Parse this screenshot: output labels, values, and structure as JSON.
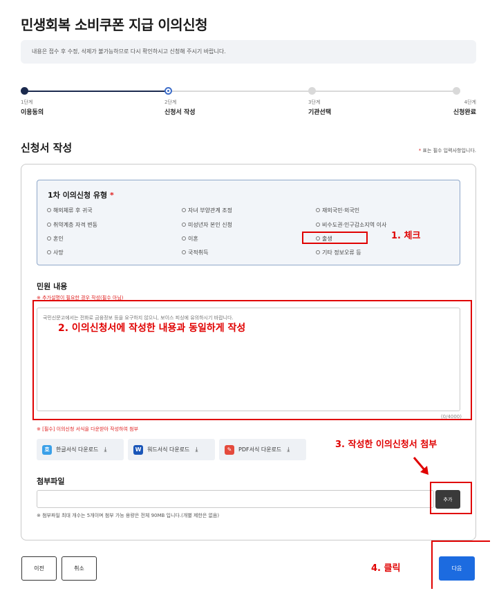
{
  "page": {
    "title": "민생회복 소비쿠폰 지급 이의신청",
    "notice": "내용은 접수 후 수정, 삭제가 불가능하므로 다시 확인하시고 신청해 주시기 바랍니다."
  },
  "steps": [
    {
      "label": "1단계",
      "name": "이용동의",
      "status": "done"
    },
    {
      "label": "2단계",
      "name": "신청서 작성",
      "status": "current"
    },
    {
      "label": "3단계",
      "name": "기관선택",
      "status": "todo"
    },
    {
      "label": "4단계",
      "name": "신청완료",
      "status": "todo"
    }
  ],
  "section": {
    "title": "신청서 작성",
    "required_star": "*",
    "required_note": " 표는 필수 입력사항입니다."
  },
  "type_group": {
    "title": "1차 이의신청 유형",
    "star": "*",
    "options": [
      "해외체류 후 귀국",
      "자녀 부양관계 조정",
      "재외국민·외국인",
      "취약계층 자격 변동",
      "미성년자 본인 신청",
      "비수도권·인구감소지역 이사",
      "혼인",
      "이혼",
      "출생",
      "사망",
      "국적취득",
      "기타 정보오류 등"
    ]
  },
  "content": {
    "title": "민원 내용",
    "note": "※ 추가설명이 필요한 경우 작성(필수 아님)",
    "placeholder": "국민신문고에서는 전화로 금융정보 등을 요구하지 않으니, 보이스 피싱에 유의하시기 바랍니다.",
    "counter": "(0/4000)"
  },
  "attachments": {
    "note": "※ [필수] 이의신청 서식을 다운받아 작성하여 첨부",
    "downloads": [
      {
        "icon": "hangul-doc-icon",
        "icon_char": "호",
        "label": "한글서식 다운로드"
      },
      {
        "icon": "word-doc-icon",
        "icon_char": "W",
        "label": "워드서식 다운로드"
      },
      {
        "icon": "pdf-doc-icon",
        "icon_char": "✎",
        "label": "PDF서식 다운로드"
      }
    ],
    "download_glyph": "⤓"
  },
  "file": {
    "title": "첨부파일",
    "add_label": "추가",
    "note": "※ 첨부파일 최대 개수는 5개이며 첨부 가능 용량은 전체 90MB 입니다.(개별 제한은 없음)"
  },
  "footer": {
    "prev_label": "이전",
    "cancel_label": "취소",
    "next_label": "다음"
  },
  "annotations": {
    "a1": "1. 체크",
    "a2": "2. 이의신청서에 작성한 내용과 동일하게 작성",
    "a3": "3. 작성한 이의신청서 첨부",
    "a4": "4. 클릭"
  },
  "colors": {
    "accent": "#1c6be0",
    "annotation": "#e00000",
    "step_done": "#1b2a4e"
  }
}
